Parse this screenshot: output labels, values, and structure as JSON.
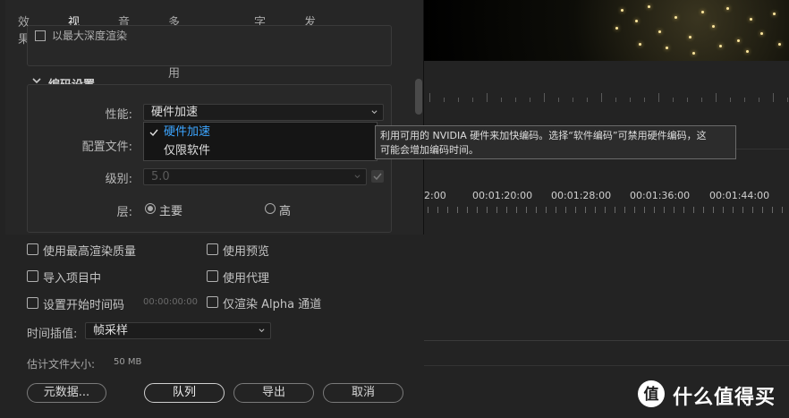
{
  "tabs": [
    {
      "label": "效果",
      "active": false
    },
    {
      "label": "视频",
      "active": true
    },
    {
      "label": "音频",
      "active": false
    },
    {
      "label": "多路复用器",
      "active": false
    },
    {
      "label": "字幕",
      "active": false
    },
    {
      "label": "发布",
      "active": false
    }
  ],
  "top_section": {
    "max_depth_label": "以最大深度渲染"
  },
  "encoding": {
    "section_title": "编码设置",
    "performance_label": "性能:",
    "performance_value": "硬件加速",
    "profile_label": "配置文件:",
    "level_label": "级别:",
    "level_value": "5.0",
    "tier_label": "层:",
    "tier_main": "主要",
    "tier_high": "高",
    "tier_selected": "主要",
    "dropdown_options": [
      "硬件加速",
      "仅限软件"
    ],
    "dropdown_selected": "硬件加速"
  },
  "tooltip": {
    "line1": "利用可用的 NVIDIA 硬件来加快编码。选择“软件编码”可禁用硬件编码，这",
    "line2": "可能会增加编码时间。"
  },
  "options": {
    "max_render_quality": "使用最高渲染质量",
    "use_previews": "使用预览",
    "import_into_project": "导入项目中",
    "use_proxies": "使用代理",
    "set_start_timecode": "设置开始时间码",
    "start_timecode_value": "00:00:00:00",
    "render_alpha_only": "仅渲染 Alpha 通道",
    "time_interpolation_label": "时间插值:",
    "time_interpolation_value": "帧采样",
    "est_file_size_label": "估计文件大小:",
    "est_file_size_value": "50 MB"
  },
  "buttons": {
    "metadata": "元数据...",
    "queue": "队列",
    "export": "导出",
    "cancel": "取消"
  },
  "timeline": {
    "timecodes": [
      "2:00",
      "00:01:20:00",
      "00:01:28:00",
      "00:01:36:00",
      "00:01:44:00"
    ]
  },
  "watermark": {
    "logo_text": "值",
    "text": "什么值得买"
  },
  "colors": {
    "accent_blue": "#3ca5ff",
    "panel_bg": "#232323"
  }
}
